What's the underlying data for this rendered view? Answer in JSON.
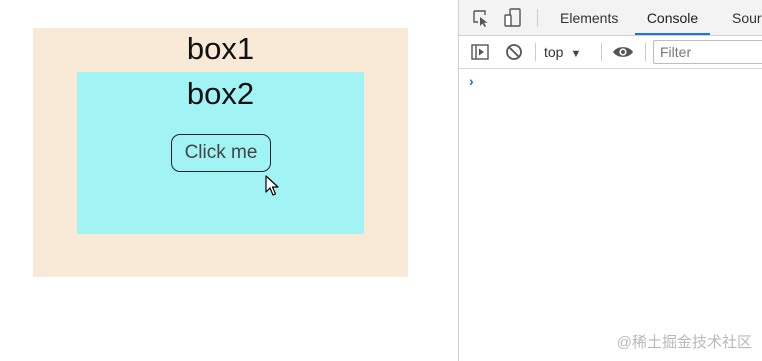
{
  "page": {
    "box1_label": "box1",
    "box2_label": "box2",
    "button_label": "Click me"
  },
  "devtools": {
    "tabs": [
      {
        "label": "Elements",
        "active": false
      },
      {
        "label": "Console",
        "active": true
      },
      {
        "label": "Sour",
        "active": false
      }
    ],
    "toolbar": {
      "context": "top",
      "filter_placeholder": "Filter"
    },
    "console_prompt": "›",
    "icons": [
      "inspect-element-icon",
      "device-toolbar-icon",
      "sidebar-toggle-icon",
      "clear-console-icon",
      "dropdown-arrow-icon",
      "live-expression-eye-icon"
    ]
  },
  "watermark": "@稀土掘金技术社区",
  "colors": {
    "box1_bg": "#f8ead6",
    "box2_bg": "#a2f3f4",
    "active_tab_accent": "#1a73e8"
  }
}
